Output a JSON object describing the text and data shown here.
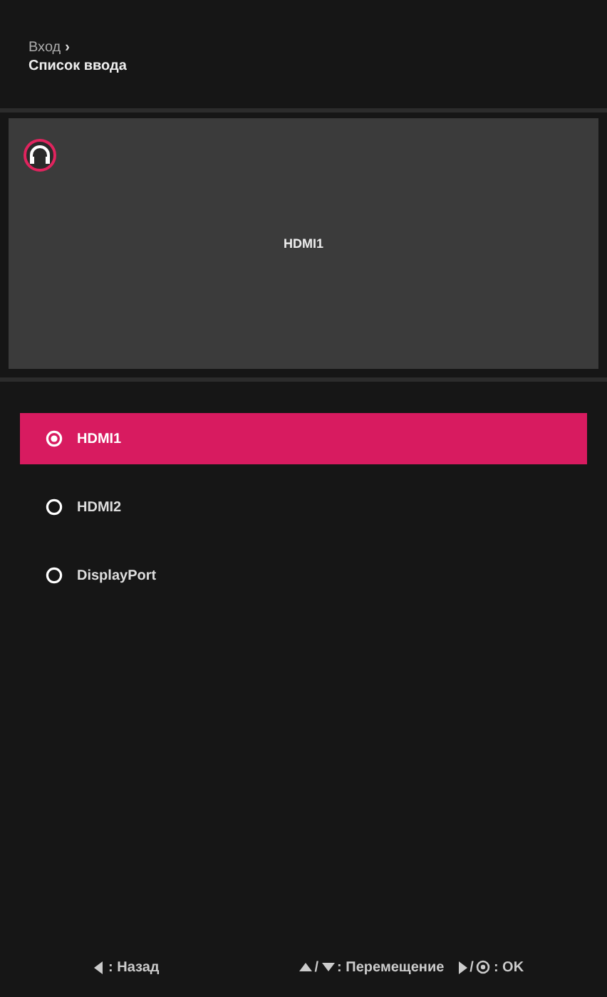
{
  "breadcrumb": {
    "parent": "Вход",
    "chevron": "›",
    "title": "Список ввода"
  },
  "preview": {
    "label": "HDMI1"
  },
  "inputs": [
    {
      "label": "HDMI1",
      "selected": true
    },
    {
      "label": "HDMI2",
      "selected": false
    },
    {
      "label": "DisplayPort",
      "selected": false
    }
  ],
  "hints": [
    {
      "kind": "back",
      "label": ": Назад"
    },
    {
      "kind": "move",
      "separator": "/",
      "label": ": Перемещение"
    },
    {
      "kind": "ok",
      "separator": "/",
      "label": ": OK"
    }
  ]
}
